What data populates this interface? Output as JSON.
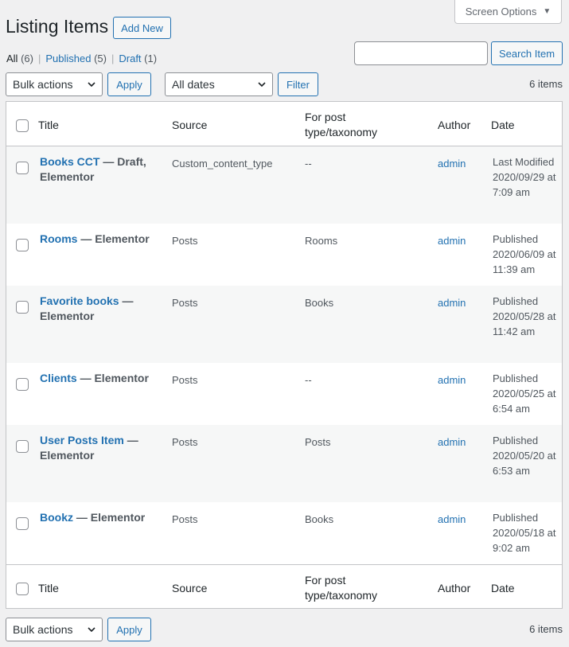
{
  "screen_options": {
    "label": "Screen Options",
    "icon": "caret-down-icon"
  },
  "page_title": "Listing Items",
  "add_new_label": "Add New",
  "views": [
    {
      "label": "All",
      "count": "(6)"
    },
    {
      "label": "Published",
      "count": "(5)"
    },
    {
      "label": "Draft",
      "count": "(1)"
    }
  ],
  "search": {
    "value": "",
    "button_label": "Search Item"
  },
  "bulk_actions": {
    "selected": "Bulk actions",
    "apply_label": "Apply"
  },
  "date_filter": {
    "selected": "All dates",
    "button_label": "Filter"
  },
  "items_count": "6 items",
  "columns": {
    "title": "Title",
    "source": "Source",
    "type": "For post type/taxonomy",
    "author": "Author",
    "date": "Date"
  },
  "rows": [
    {
      "title": "Books CCT",
      "state": " — Draft, Elementor",
      "source": "Custom_content_type",
      "type": "--",
      "author": "admin",
      "date": "Last Modified 2020/09/29 at 7:09 am"
    },
    {
      "title": "Rooms",
      "state": " — Elementor",
      "source": "Posts",
      "type": "Rooms",
      "author": "admin",
      "date": "Published 2020/06/09 at 11:39 am"
    },
    {
      "title": "Favorite books",
      "state": " — Elementor",
      "source": "Posts",
      "type": "Books",
      "author": "admin",
      "date": "Published 2020/05/28 at 11:42 am"
    },
    {
      "title": "Clients",
      "state": " — Elementor",
      "source": "Posts",
      "type": "--",
      "author": "admin",
      "date": "Published 2020/05/25 at 6:54 am"
    },
    {
      "title": "User Posts Item",
      "state": " — Elementor",
      "source": "Posts",
      "type": "Posts",
      "author": "admin",
      "date": "Published 2020/05/20 at 6:53 am"
    },
    {
      "title": "Bookz",
      "state": " — Elementor",
      "source": "Posts",
      "type": "Books",
      "author": "admin",
      "date": "Published 2020/05/18 at 9:02 am"
    }
  ]
}
